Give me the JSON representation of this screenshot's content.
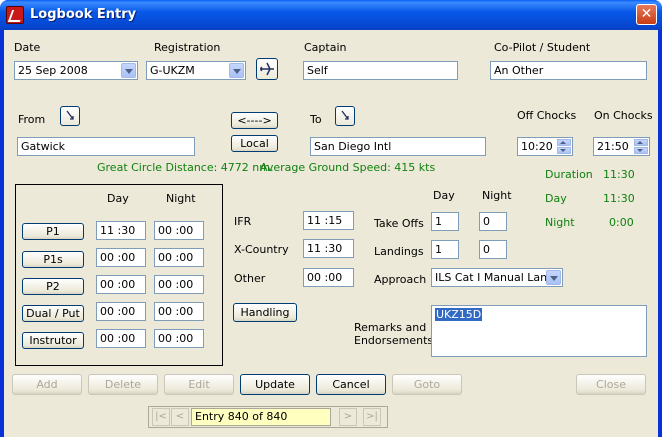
{
  "window": {
    "title": "Logbook Entry"
  },
  "date": {
    "label": "Date",
    "value": "25 Sep 2008"
  },
  "registration": {
    "label": "Registration",
    "value": "G-UKZM"
  },
  "captain": {
    "label": "Captain",
    "value": "Self"
  },
  "copilot": {
    "label": "Co-Pilot / Student",
    "value": "An Other"
  },
  "from": {
    "label": "From",
    "value": "Gatwick"
  },
  "to": {
    "label": "To",
    "value": "San Diego Intl"
  },
  "swap_button": "<---->",
  "local_button": "Local",
  "off_chocks": {
    "label": "Off Chocks",
    "value": "10:20"
  },
  "on_chocks": {
    "label": "On Chocks",
    "value": "21:50"
  },
  "great_circle": "Great Circle Distance: 4772 nm.",
  "avg_speed": "Average Ground Speed: 415 kts",
  "summary": {
    "duration_label": "Duration",
    "duration": "11:30",
    "day_label": "Day",
    "day": "11:30",
    "night_label": "Night",
    "night": "0:00"
  },
  "roles": {
    "day_header": "Day",
    "night_header": "Night",
    "rows": [
      {
        "label": "P1",
        "day": "11 :30",
        "night": "00 :00"
      },
      {
        "label": "P1s",
        "day": "00 :00",
        "night": "00 :00"
      },
      {
        "label": "P2",
        "day": "00 :00",
        "night": "00 :00"
      },
      {
        "label": "Dual / Put",
        "day": "00 :00",
        "night": "00 :00"
      },
      {
        "label": "Instrutor",
        "day": "00 :00",
        "night": "00 :00"
      }
    ]
  },
  "ifr": {
    "label": "IFR",
    "value": "11 :15"
  },
  "xcountry": {
    "label": "X-Country",
    "value": "11 :30"
  },
  "other": {
    "label": "Other",
    "value": "00 :00"
  },
  "handling_button": "Handling",
  "takeoffs": {
    "label": "Take Offs",
    "day_header": "Day",
    "night_header": "Night",
    "day": "1",
    "night": "0"
  },
  "landings": {
    "label": "Landings",
    "day": "1",
    "night": "0"
  },
  "approach": {
    "label": "Approach",
    "value": "ILS Cat I Manual Land"
  },
  "remarks": {
    "label_line1": "Remarks and",
    "label_line2": "Endorsements",
    "value": "UKZ15D"
  },
  "buttons": {
    "add": "Add",
    "delete": "Delete",
    "edit": "Edit",
    "update": "Update",
    "cancel": "Cancel",
    "goto": "Goto",
    "close": "Close"
  },
  "nav": {
    "first": "|<",
    "prev": "<",
    "entry": "Entry 840 of 840",
    "next": ">",
    "last": ">|"
  }
}
